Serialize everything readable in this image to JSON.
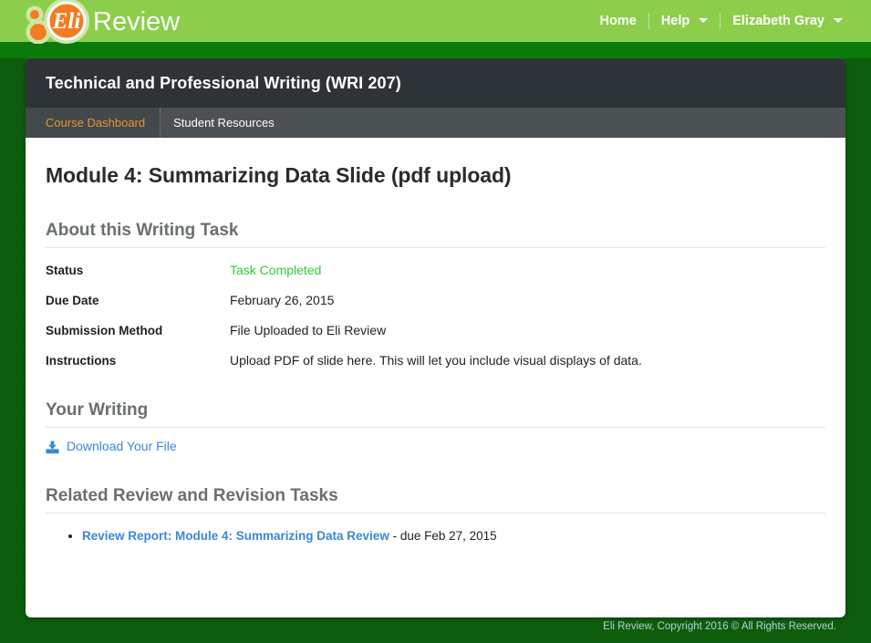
{
  "brand": {
    "logo_name": "eli-review-logo",
    "logo_mark_text": "Eli",
    "logo_word": "Review",
    "light_green": "#8cce4c",
    "orange": "#f47b20",
    "dark_green": "#0c5c0c"
  },
  "topnav": {
    "items": [
      {
        "label": "Home",
        "has_caret": false
      },
      {
        "label": "Help",
        "has_caret": true
      },
      {
        "label": "Elizabeth Gray",
        "has_caret": true
      }
    ]
  },
  "course": {
    "title": "Technical and Professional Writing (WRI 207)",
    "tabs": [
      {
        "label": "Course Dashboard",
        "active": true
      },
      {
        "label": "Student Resources",
        "active": false
      }
    ]
  },
  "page": {
    "title": "Module 4: Summarizing Data Slide (pdf upload)"
  },
  "about": {
    "heading": "About this Writing Task",
    "rows": [
      {
        "label": "Status",
        "value": "Task Completed",
        "status": true
      },
      {
        "label": "Due Date",
        "value": "February 26, 2015",
        "status": false
      },
      {
        "label": "Submission Method",
        "value": "File Uploaded to Eli Review",
        "status": false
      },
      {
        "label": "Instructions",
        "value": "Upload PDF of slide here. This will let you include visual displays of data.",
        "status": false
      }
    ],
    "status_color": "#33cc33"
  },
  "writing": {
    "heading": "Your Writing",
    "download_icon": "download-icon",
    "download_label": "Download Your File",
    "link_color": "#3a87d8"
  },
  "related": {
    "heading": "Related Review and Revision Tasks",
    "items": [
      {
        "link": "Review Report: Module 4: Summarizing Data Review",
        "suffix": " - due Feb 27, 2015"
      }
    ]
  },
  "footer": {
    "text": "Eli Review, Copyright 2016 © All Rights Reserved."
  }
}
